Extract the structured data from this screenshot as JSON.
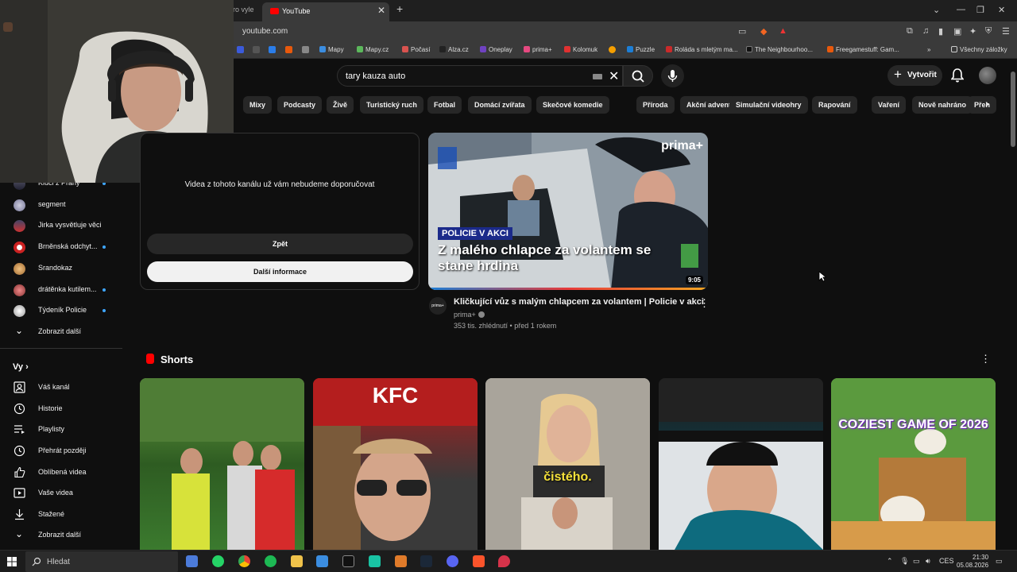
{
  "browser": {
    "prev_tab_label": "ro vyle",
    "active_tab_title": "YouTube",
    "url": "youtube.com",
    "bookmarks": [
      "Mapy",
      "Mapy.cz",
      "Počasí",
      "Alza.cz",
      "Oneplay",
      "prima+",
      "Kolomuk",
      "Puzzle",
      "Roláda s mletým ma...",
      "The Neighbourhoo...",
      "Freegamestuff: Gam..."
    ],
    "all_bookmarks_label": "Všechny záložky"
  },
  "header": {
    "search_value": "tary kauza auto",
    "create_label": "Vytvořit"
  },
  "chips": [
    "Mixy",
    "Podcasty",
    "Živě",
    "Turistický ruch",
    "Fotbal",
    "Domácí zvířata",
    "Skečové komedie",
    "Příroda",
    "Akční adventury",
    "Simulační videohry",
    "Rapování",
    "Vaření",
    "Nově nahráno",
    "Přeh"
  ],
  "sidebar": {
    "subscriptions": [
      {
        "label": "Kluci z Prahy",
        "new": true
      },
      {
        "label": "segment",
        "new": false
      },
      {
        "label": "Jirka vysvětluje věci",
        "new": false
      },
      {
        "label": "Brněnská odchyt...",
        "new": true
      },
      {
        "label": "Srandokaz",
        "new": false
      },
      {
        "label": "drátěnka kutilem...",
        "new": true
      },
      {
        "label": "Týdeník Policie",
        "new": true
      }
    ],
    "show_more_1": "Zobrazit další",
    "you_heading": "Vy",
    "you_items": [
      "Váš kanál",
      "Historie",
      "Playlisty",
      "Přehrát později",
      "Oblíbená videa",
      "Vaše videa",
      "Stažené"
    ],
    "show_more_2": "Zobrazit další"
  },
  "dismissed_card": {
    "message": "Videa z tohoto kanálu už vám nebudeme doporučovat",
    "back_label": "Zpět",
    "more_info_label": "Další informace"
  },
  "video": {
    "thumb_brand": "prima+",
    "thumb_badge": "POLICIE V AKCI",
    "thumb_headline": "Z malého chlapce za volantem se stane hrdina",
    "duration": "9:05",
    "channel_avatar": "prima+",
    "title": "Kličkující vůz s malým chlapcem za volantem | Policie v akci",
    "channel": "prima+",
    "meta": "353 tis. zhlédnutí • před 1 rokem"
  },
  "shorts": {
    "heading": "Shorts",
    "items": [
      {
        "overlay": "",
        "colors": [
          "#5b8a3a",
          "#2f5a23"
        ]
      },
      {
        "overlay": "KFC",
        "colors": [
          "#b31b1b",
          "#3a3a3a"
        ]
      },
      {
        "overlay": "čistého.",
        "colors": [
          "#b8b4ad",
          "#6a645c"
        ]
      },
      {
        "overlay": "",
        "colors": [
          "#1a1a1a",
          "#0e5a6e"
        ]
      },
      {
        "overlay": "COZIEST GAME OF 2026",
        "colors": [
          "#6ba54a",
          "#c58f4a"
        ]
      }
    ]
  },
  "taskbar": {
    "search_label": "Hledat",
    "lang": "CES",
    "time": "21:30",
    "date": "05.08.2026"
  },
  "colors": {
    "background": "#0f0f0f",
    "accent_red": "#ff0000",
    "new_dot": "#3ea6ff"
  }
}
